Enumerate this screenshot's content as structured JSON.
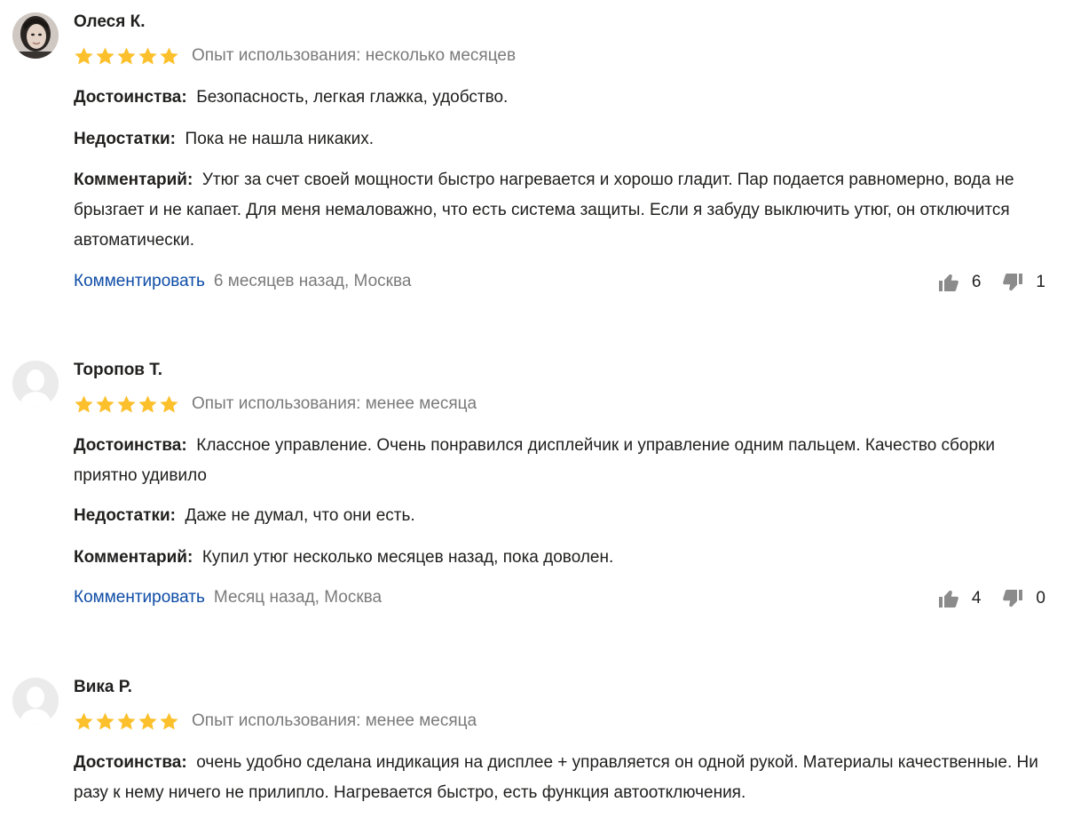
{
  "colors": {
    "star": "#fcc02c",
    "link": "#0e4ca6",
    "muted": "#7a7a7a"
  },
  "icons": {
    "like": "thumbs-up-icon",
    "dislike": "thumbs-down-icon",
    "star": "star-icon"
  },
  "reviews": [
    {
      "author": "Олеся К.",
      "rating": 5,
      "experience": "Опыт использования: несколько месяцев",
      "pros_label": "Достоинства:",
      "pros": "Безопасность, легкая глажка, удобство.",
      "cons_label": "Недостатки:",
      "cons": "Пока не нашла никаких.",
      "comment_label": "Комментарий:",
      "comment": "Утюг за счет своей мощности быстро нагревается и хорошо гладит. Пар подается равномерно, вода не брызгает и не капает. Для меня немаловажно, что есть система защиты. Если я забуду выключить утюг, он отключится автоматически.",
      "reply_label": "Комментировать",
      "meta": "6 месяцев назад, Москва",
      "likes": "6",
      "dislikes": "1"
    },
    {
      "author": "Торопов Т.",
      "rating": 5,
      "experience": "Опыт использования: менее месяца",
      "pros_label": "Достоинства:",
      "pros": "Классное управление. Очень понравился дисплейчик и управление одним пальцем. Качество сборки приятно удивило",
      "cons_label": "Недостатки:",
      "cons": "Даже не думал, что они есть.",
      "comment_label": "Комментарий:",
      "comment": "Купил утюг несколько месяцев назад, пока доволен.",
      "reply_label": "Комментировать",
      "meta": "Месяц назад, Москва",
      "likes": "4",
      "dislikes": "0"
    },
    {
      "author": "Вика Р.",
      "rating": 5,
      "experience": "Опыт использования: менее месяца",
      "pros_label": "Достоинства:",
      "pros": "очень удобно сделана индикация на дисплее + управляется он одной рукой. Материалы качественные. Ни разу к нему ничего не прилипло. Нагревается быстро, есть функция автоотключения."
    }
  ]
}
